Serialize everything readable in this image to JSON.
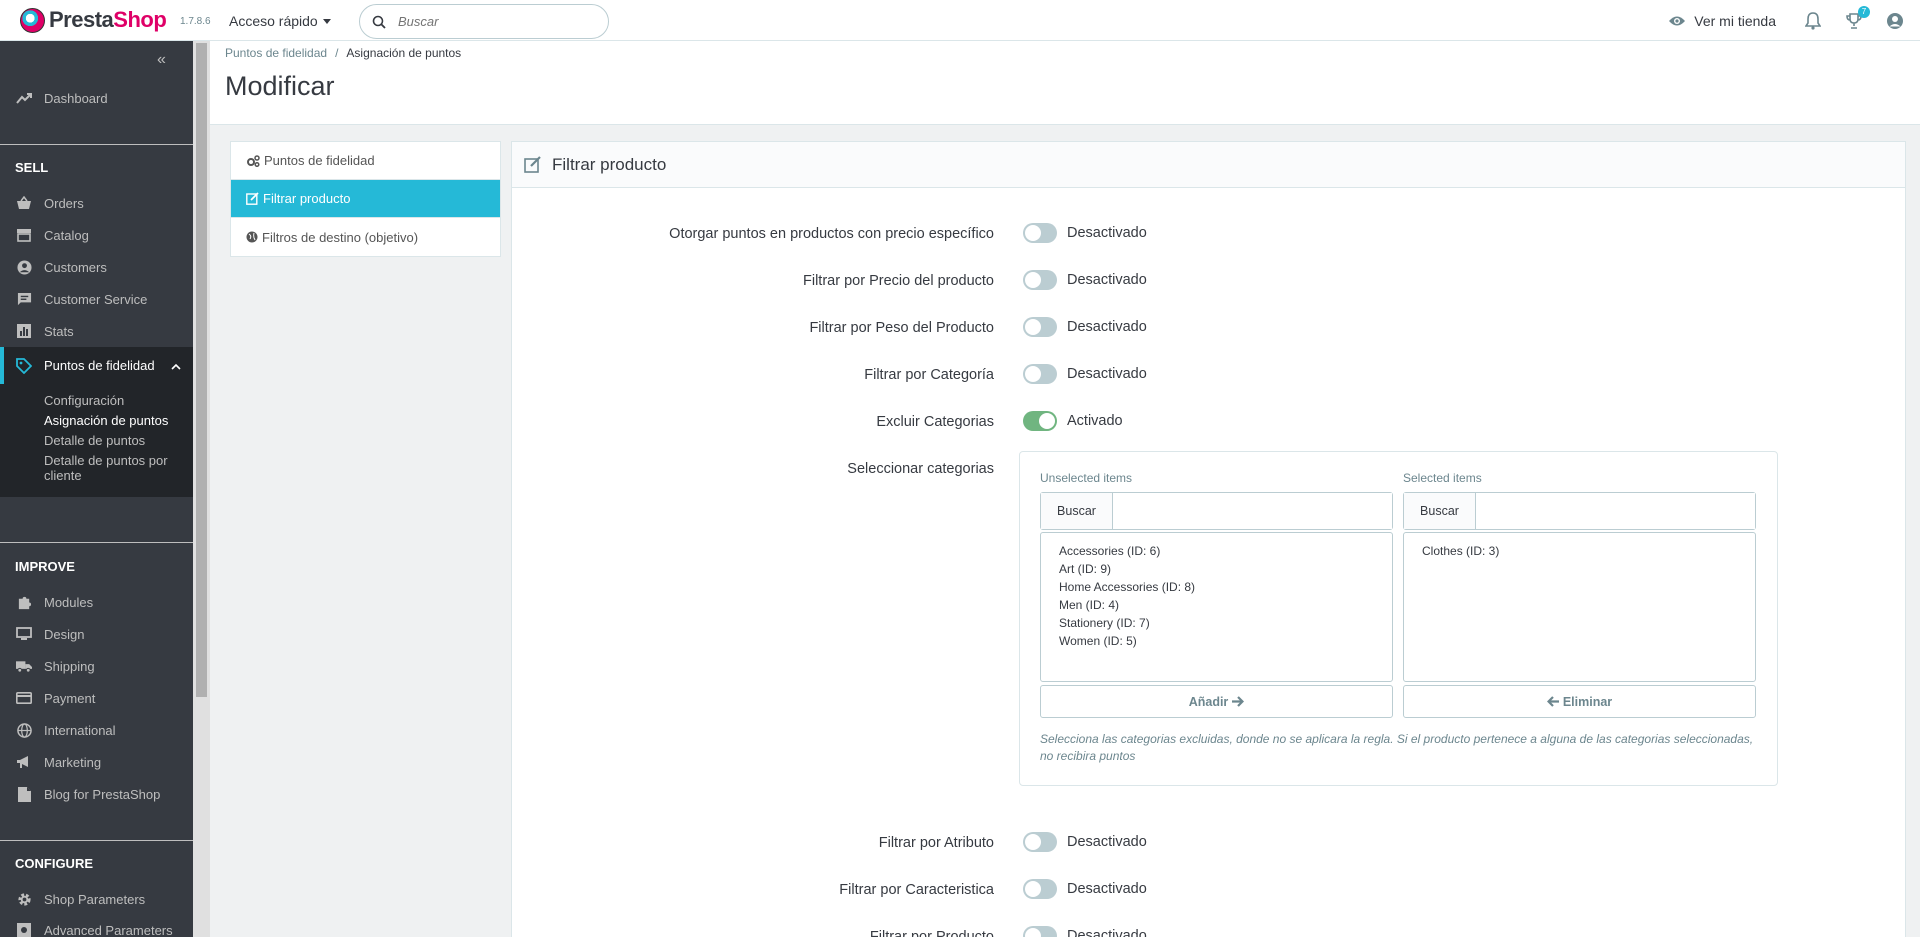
{
  "header": {
    "brand_left": "Presta",
    "brand_right": "Shop",
    "version": "1.7.8.6",
    "quick_access": "Acceso rápido",
    "search_placeholder": "Buscar",
    "view_shop": "Ver mi tienda",
    "orders_badge": "7"
  },
  "sidebar": {
    "dashboard": "Dashboard",
    "sell_title": "SELL",
    "sell_items": [
      "Orders",
      "Catalog",
      "Customers",
      "Customer Service",
      "Stats",
      "Puntos de fidelidad"
    ],
    "submenu": [
      "Configuración",
      "Asignación de puntos",
      "Detalle de puntos",
      "Detalle de puntos por cliente"
    ],
    "improve_title": "IMPROVE",
    "improve_items": [
      "Modules",
      "Design",
      "Shipping",
      "Payment",
      "International",
      "Marketing",
      "Blog for PrestaShop"
    ],
    "configure_title": "CONFIGURE",
    "configure_items": [
      "Shop Parameters",
      "Advanced Parameters"
    ]
  },
  "page": {
    "breadcrumb_parent": "Puntos de fidelidad",
    "breadcrumb_current": "Asignación de puntos",
    "title": "Modificar"
  },
  "tabs": [
    "Puntos de fidelidad",
    "Filtrar producto",
    "Filtros de destino (objetivo)"
  ],
  "panel": {
    "title": "Filtrar producto",
    "rows": [
      {
        "label": "Otorgar puntos en productos con precio específico",
        "state": "Desactivado"
      },
      {
        "label": "Filtrar por Precio del producto",
        "state": "Desactivado"
      },
      {
        "label": "Filtrar por Peso del Producto",
        "state": "Desactivado"
      },
      {
        "label": "Filtrar por Categoría",
        "state": "Desactivado"
      },
      {
        "label": "Excluir Categorias",
        "state": "Activado"
      }
    ],
    "categories_label": "Seleccionar categorias",
    "unselected_title": "Unselected items",
    "selected_title": "Selected items",
    "search_label": "Buscar",
    "unselected": [
      "Accessories (ID: 6)",
      "Art (ID: 9)",
      "Home Accessories (ID: 8)",
      "Men (ID: 4)",
      "Stationery (ID: 7)",
      "Women (ID: 5)"
    ],
    "selected": [
      "Clothes (ID: 3)"
    ],
    "add_button": "Añadir",
    "remove_button": "Eliminar",
    "help_text": "Selecciona las categorias excluidas, donde no se aplicara la regla. Si el producto pertenece a alguna de las categorias seleccionadas, no recibira puntos",
    "rows_bottom": [
      {
        "label": "Filtrar por Atributo",
        "state": "Desactivado"
      },
      {
        "label": "Filtrar por Caracteristica",
        "state": "Desactivado"
      },
      {
        "label": "Filtrar por Producto",
        "state": "Desactivado"
      }
    ]
  },
  "colors": {
    "accent": "#25b9d7",
    "sidebar": "#363a41",
    "toggle_on": "#70b580",
    "brand_pink": "#df0067"
  }
}
